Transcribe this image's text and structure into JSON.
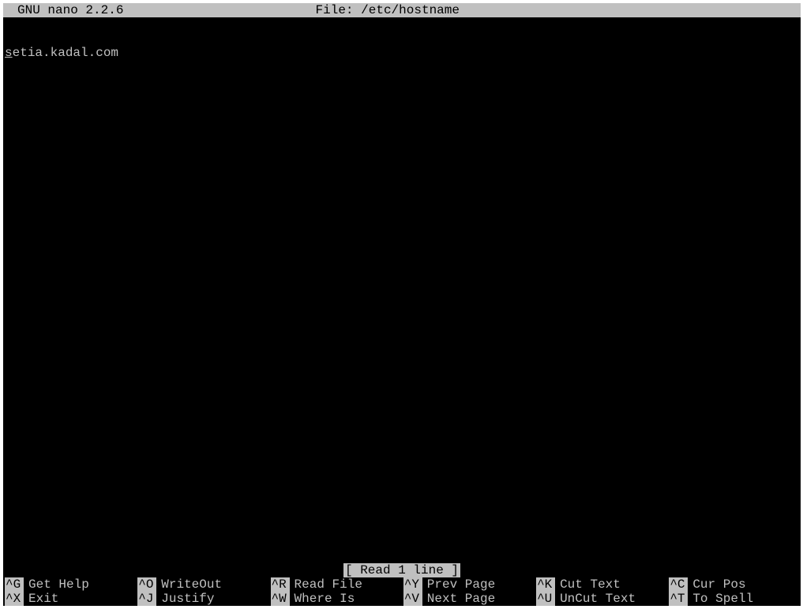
{
  "titlebar": {
    "version": "GNU nano 2.2.6",
    "file_prefix": "File:",
    "file_path": "/etc/hostname"
  },
  "content": {
    "cursor_char": "s",
    "rest": "etia.kadal.com"
  },
  "status": {
    "message": "[ Read 1 line ]"
  },
  "shortcuts": {
    "row1": [
      {
        "key": "^G",
        "label": "Get Help"
      },
      {
        "key": "^O",
        "label": "WriteOut"
      },
      {
        "key": "^R",
        "label": "Read File"
      },
      {
        "key": "^Y",
        "label": "Prev Page"
      },
      {
        "key": "^K",
        "label": "Cut Text"
      },
      {
        "key": "^C",
        "label": "Cur Pos"
      }
    ],
    "row2": [
      {
        "key": "^X",
        "label": "Exit"
      },
      {
        "key": "^J",
        "label": "Justify"
      },
      {
        "key": "^W",
        "label": "Where Is"
      },
      {
        "key": "^V",
        "label": "Next Page"
      },
      {
        "key": "^U",
        "label": "UnCut Text"
      },
      {
        "key": "^T",
        "label": "To Spell"
      }
    ]
  }
}
